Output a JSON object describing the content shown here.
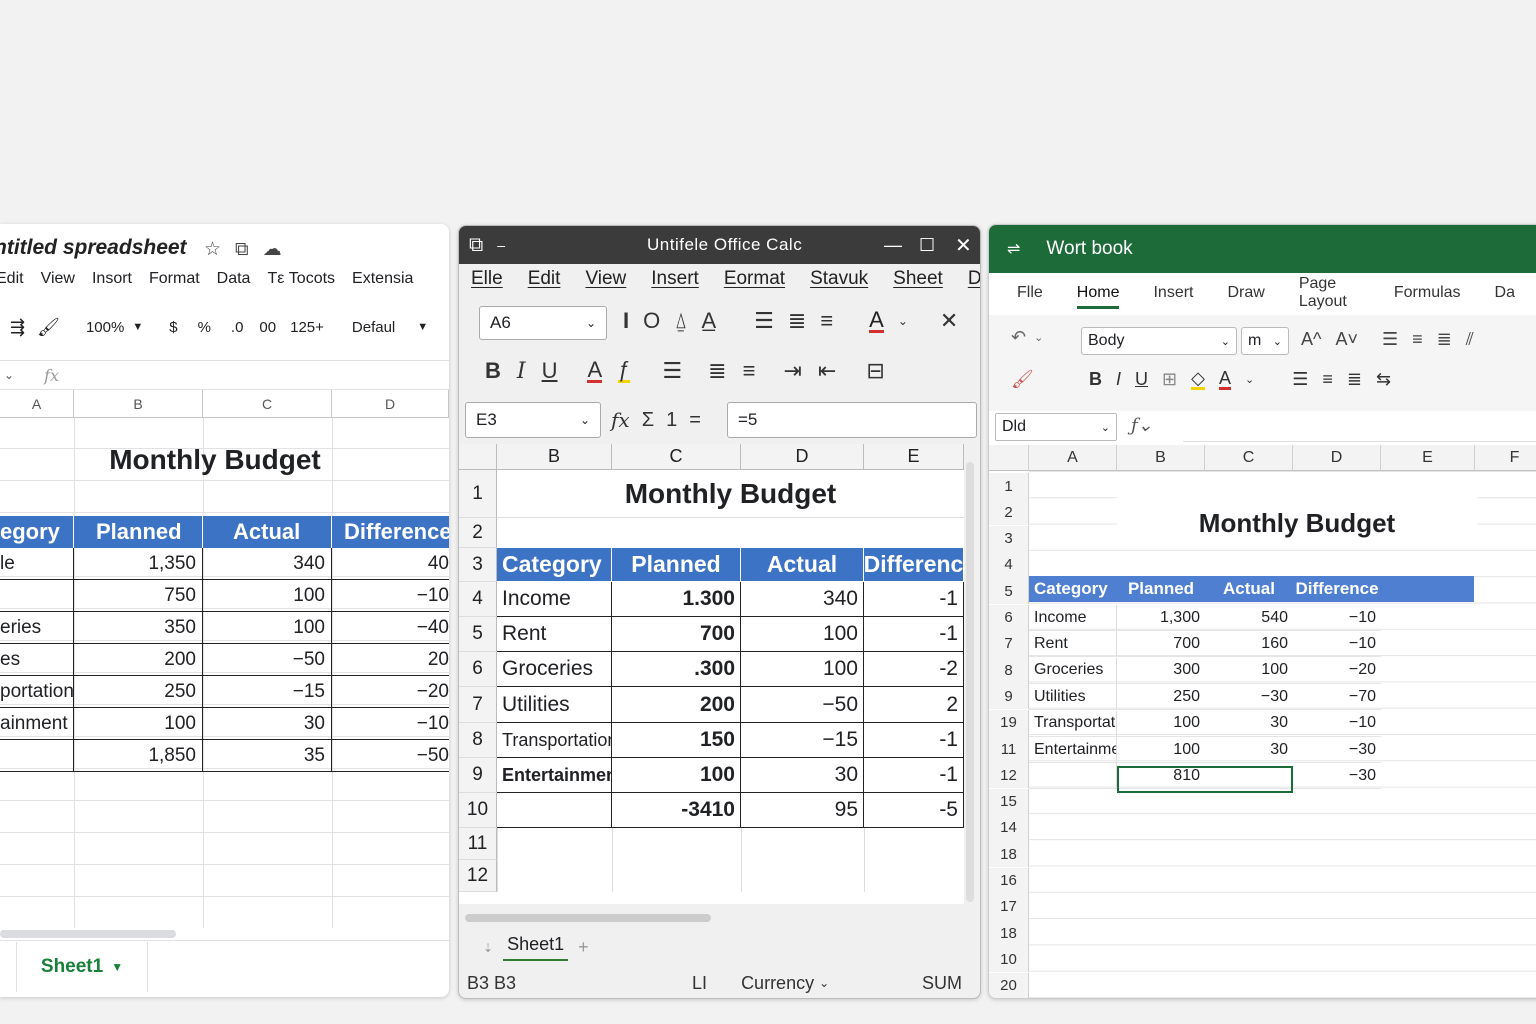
{
  "gs": {
    "title": "ntitled spreadsheet",
    "menu": [
      "Edit",
      "View",
      "Insort",
      "Format",
      "Data",
      "Tε Tocots",
      "Extensia"
    ],
    "toolbar": {
      "zoom": "100%",
      "currency": "$",
      "percent": "%",
      "dec": "00",
      "more": "125+",
      "font": "Defaul"
    },
    "fx": "fx",
    "columns": [
      "A",
      "B",
      "C",
      "D"
    ],
    "sheet_title": "Monthly Budget",
    "headers": [
      "egory",
      "Planned",
      "Actual",
      "Difference"
    ],
    "rows": [
      [
        "le",
        "1,350",
        "340",
        "40"
      ],
      [
        "",
        "750",
        "100",
        "−10"
      ],
      [
        "eries",
        "350",
        "100",
        "−40"
      ],
      [
        "es",
        "200",
        "−50",
        "20"
      ],
      [
        "portation",
        "250",
        "−15",
        "−20"
      ],
      [
        "ainment",
        "100",
        "30",
        "−10"
      ],
      [
        "",
        "1,850",
        "35",
        "−50"
      ]
    ],
    "sheet_tab": "Sheet1"
  },
  "lo": {
    "title": "Untifele Office Calc",
    "menu": [
      "Elle",
      "Edit",
      "View",
      "Insert",
      "Eormat",
      "Stavuk",
      "Sheet",
      "Data"
    ],
    "font_name": "A6",
    "name_box": "E3",
    "formula": "=5",
    "columns": [
      "B",
      "C",
      "D",
      "E"
    ],
    "row_numbers": [
      "1",
      "2",
      "3",
      "4",
      "5",
      "6",
      "7",
      "8",
      "9",
      "10",
      "11",
      "12"
    ],
    "sheet_title": "Monthly Budget",
    "headers": [
      "Category",
      "Planned",
      "Actual",
      "Differenc"
    ],
    "rows": [
      [
        "Income",
        "1.300",
        "340",
        "-1"
      ],
      [
        "Rent",
        "700",
        "100",
        "-1"
      ],
      [
        "Groceries",
        ".300",
        "100",
        "-2"
      ],
      [
        "Utilities",
        "200",
        "−50",
        "2"
      ],
      [
        "Transportation",
        "150",
        "−15",
        "-1"
      ],
      [
        "Entertainment",
        "100",
        "30",
        "-1"
      ],
      [
        "",
        "-3410",
        "95",
        "-5"
      ]
    ],
    "sheet_tab": "Sheet1",
    "status": {
      "sel": "B3 B3",
      "mid": "LI",
      "format": "Currency",
      "sum": "SUM"
    }
  },
  "xl": {
    "title": "Wort book",
    "tabs": [
      "Flle",
      "Home",
      "Insert",
      "Draw",
      "Page Layout",
      "Formulas",
      "Da"
    ],
    "font_name": "Body",
    "font_size": "m",
    "name_box": "Dld",
    "columns": [
      "A",
      "B",
      "C",
      "D",
      "E",
      "F"
    ],
    "row_numbers": [
      "1",
      "2",
      "3",
      "4",
      "5",
      "6",
      "7",
      "8",
      "9",
      "19",
      "11",
      "12",
      "15",
      "14",
      "18",
      "16",
      "17",
      "18",
      "10",
      "20"
    ],
    "sheet_title": "Monthly Budget",
    "headers": [
      "Category",
      "Planned",
      "Actual",
      "Difference"
    ],
    "rows": [
      [
        "Income",
        "1,300",
        "540",
        "−10"
      ],
      [
        "Rent",
        "700",
        "160",
        "−10"
      ],
      [
        "Groceries",
        "300",
        "100",
        "−20"
      ],
      [
        "Utilities",
        "250",
        "−30",
        "−70"
      ],
      [
        "Transportati",
        "100",
        "30",
        "−10"
      ],
      [
        "Entertainme",
        "100",
        "30",
        "−30"
      ],
      [
        "",
        "810",
        "",
        "−30"
      ]
    ]
  }
}
